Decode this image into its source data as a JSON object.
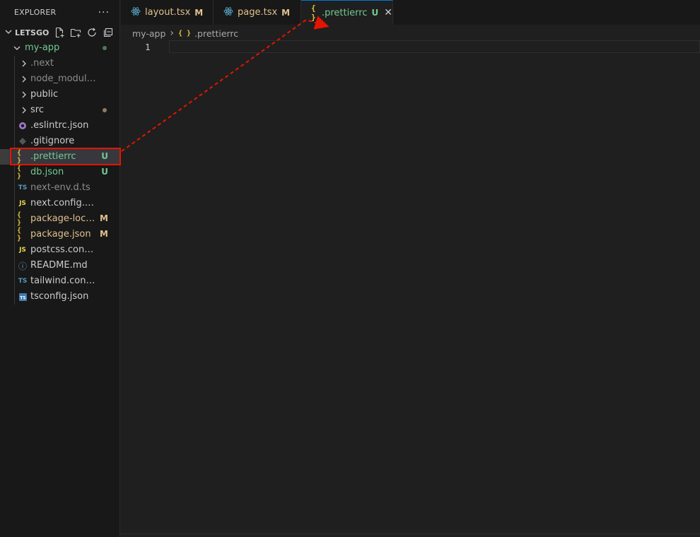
{
  "sidebar": {
    "title": "EXPLORER",
    "more": "···",
    "workspace": "LETSGO",
    "items": [
      {
        "label": "my-app",
        "kind": "folder-open",
        "color": "#73c991",
        "dot": "#4f7a55"
      },
      {
        "label": ".next",
        "kind": "folder",
        "color": "#8c8c8c"
      },
      {
        "label": "node_modules",
        "kind": "folder",
        "color": "#8c8c8c"
      },
      {
        "label": "public",
        "kind": "folder",
        "color": "#cccccc"
      },
      {
        "label": "src",
        "kind": "folder",
        "color": "#cccccc",
        "dot": "#8a7f5e"
      },
      {
        "label": ".eslintrc.json",
        "kind": "file",
        "icon": "eslint-icon",
        "color": "#cccccc"
      },
      {
        "label": ".gitignore",
        "kind": "file",
        "icon": "git-icon",
        "color": "#cccccc"
      },
      {
        "label": ".prettierrc",
        "kind": "file",
        "icon": "json-braces-icon",
        "color": "#73c991",
        "badge": "U"
      },
      {
        "label": "db.json",
        "kind": "file",
        "icon": "json-braces-icon",
        "color": "#73c991",
        "badge": "U"
      },
      {
        "label": "next-env.d.ts",
        "kind": "file",
        "icon": "ts-icon",
        "color": "#8c8c8c"
      },
      {
        "label": "next.config.mjs",
        "kind": "file",
        "icon": "js-icon",
        "color": "#cccccc"
      },
      {
        "label": "package-lock.j...",
        "kind": "file",
        "icon": "json-braces-icon",
        "color": "#e2c08d",
        "badge": "M"
      },
      {
        "label": "package.json",
        "kind": "file",
        "icon": "json-braces-icon",
        "color": "#e2c08d",
        "badge": "M"
      },
      {
        "label": "postcss.config.js",
        "kind": "file",
        "icon": "js-icon",
        "color": "#cccccc"
      },
      {
        "label": "README.md",
        "kind": "file",
        "icon": "info-icon",
        "color": "#cccccc"
      },
      {
        "label": "tailwind.config.ts",
        "kind": "file",
        "icon": "ts-icon",
        "color": "#cccccc"
      },
      {
        "label": "tsconfig.json",
        "kind": "file",
        "icon": "tsconfig-icon",
        "color": "#cccccc"
      }
    ]
  },
  "tabs": [
    {
      "label": "layout.tsx",
      "badge": "M",
      "icon": "react-icon",
      "color": "#e2c08d"
    },
    {
      "label": "page.tsx",
      "badge": "M",
      "icon": "react-icon",
      "color": "#e2c08d"
    },
    {
      "label": ".prettierrc",
      "badge": "U",
      "icon": "json-braces-icon",
      "color": "#73c991",
      "active": true,
      "close": "✕"
    }
  ],
  "breadcrumb": {
    "folder": "my-app",
    "separator": "›",
    "file": ".prettierrc"
  },
  "editor": {
    "line_number": "1"
  },
  "icons": {
    "braces": "{ }",
    "ts": "TS",
    "js": "JS",
    "info": "ⓘ"
  },
  "colors": {
    "added": "#73c991",
    "modified": "#e2c08d",
    "accent": "#0078d4",
    "annotation": "#e51400"
  }
}
